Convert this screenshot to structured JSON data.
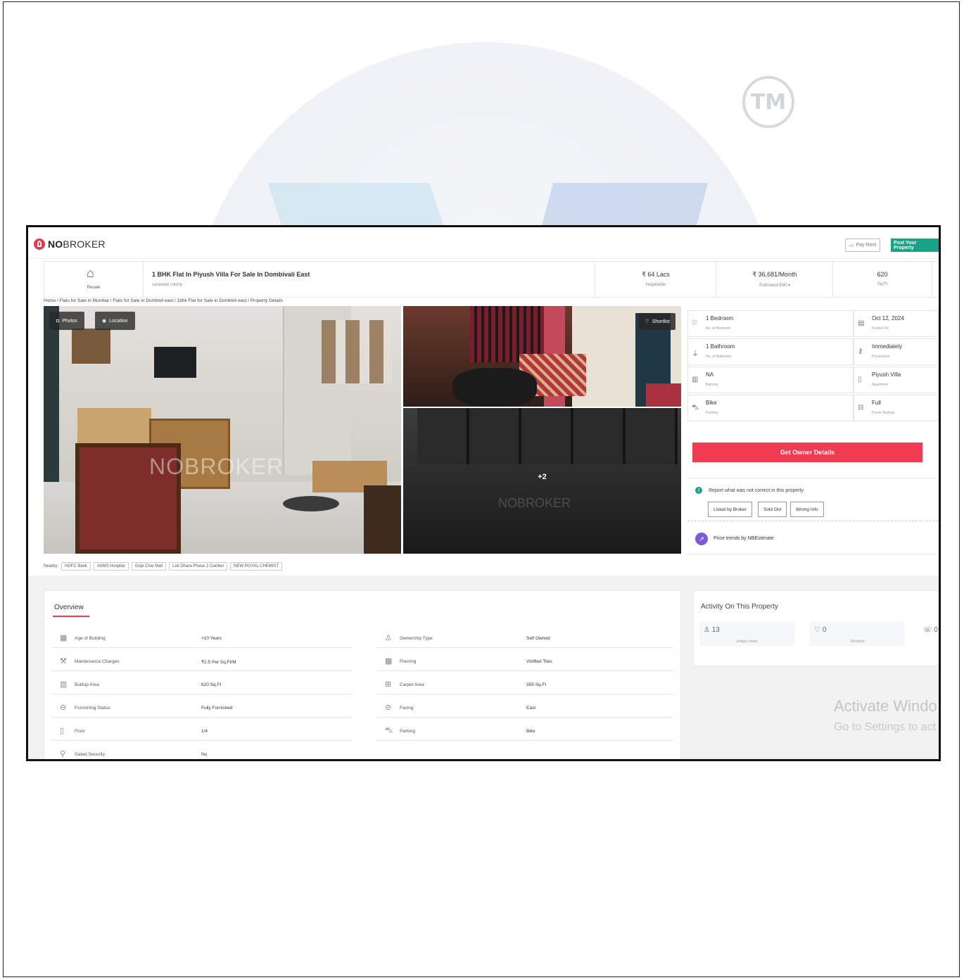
{
  "colors": {
    "brand_red": "#f03c50",
    "brand_green": "#18a389",
    "report_teal": "#19a38a",
    "trend_purple": "#7c5cd6"
  },
  "watermark": {
    "tm": "TM"
  },
  "header": {
    "logo_bold": "NO",
    "logo_rest": "BROKER",
    "pay_rent": "Pay Rent",
    "post_property": "Post Your Property"
  },
  "property": {
    "type_label": "Resale",
    "title": "1 BHK Flat In Piyush Villa For Sale In Dombivali East",
    "subtitle": "saraswat colony",
    "price": "₹ 64 Lacs",
    "price_note": "Negotiable",
    "emi": "₹ 36,681/Month",
    "emi_note": "Estimated EMI ▾",
    "area": "620",
    "area_unit": "Sq.Ft"
  },
  "breadcrumb": "Home / Flats for Sale in Mumbai / Flats for Sale in Dombivli east / 1bhk Flat for Sale in Dombivli east / Property Details",
  "gallery": {
    "photos_label": "Photos",
    "location_label": "Location",
    "shortlist_label": "Shortlist",
    "more_count": "+2",
    "watermark": "NOBROKER"
  },
  "nearby": {
    "label": "Nearby:",
    "places": [
      "HDFC Bank",
      "AIIMS Hospital",
      "Gopi Cine Mall",
      "Lok Dhara Phase 2 Garden",
      "NEW ROYAL CHEMIST"
    ]
  },
  "details": [
    {
      "icon": "bed-icon",
      "value": "1 Bedroom",
      "label": "No. of Bedroom"
    },
    {
      "icon": "calendar-icon",
      "value": "Oct 12, 2024",
      "label": "Posted On"
    },
    {
      "icon": "bath-icon",
      "value": "1 Bathroom",
      "label": "No. of Bathroom"
    },
    {
      "icon": "key-icon",
      "value": "Immediately",
      "label": "Possession"
    },
    {
      "icon": "balcony-icon",
      "value": "NA",
      "label": "Balcony"
    },
    {
      "icon": "building-icon",
      "value": "Piyush Villa",
      "label": "Apartment"
    },
    {
      "icon": "parking-icon",
      "value": "Bike",
      "label": "Parking"
    },
    {
      "icon": "power-icon",
      "value": "Full",
      "label": "Power Backup"
    }
  ],
  "owner_button": "Get Owner Details",
  "report": {
    "text": "Report what was not correct in this property",
    "options": [
      "Listed by Broker",
      "Sold Out",
      "Wrong Info"
    ]
  },
  "trends": {
    "label": "Price trends by NBEstimate"
  },
  "overview": {
    "title": "Overview",
    "left": [
      {
        "key": "Age of Building",
        "value": ">10 Years"
      },
      {
        "key": "Maintenance Charges",
        "value": "₹2.5 Per Sq.Ft/M"
      },
      {
        "key": "Builtup Area",
        "value": "620 Sq.Ft"
      },
      {
        "key": "Furnishing Status",
        "value": "Fully Furnished"
      },
      {
        "key": "Floor",
        "value": "1/4"
      },
      {
        "key": "Gated Security",
        "value": "No"
      }
    ],
    "right": [
      {
        "key": "Ownership Type",
        "value": "Self Owned"
      },
      {
        "key": "Flooring",
        "value": "Vitrified Tiles"
      },
      {
        "key": "Carpet Area",
        "value": "355 Sq.Ft"
      },
      {
        "key": "Facing",
        "value": "East"
      },
      {
        "key": "Parking",
        "value": "Bike"
      }
    ]
  },
  "activity": {
    "title": "Activity On This Property",
    "stats": [
      {
        "icon": "person-icon",
        "value": "13",
        "label": "Unique Views"
      },
      {
        "icon": "heart-icon",
        "value": "0",
        "label": "Shortlists"
      },
      {
        "icon": "contact-icon",
        "value": "0",
        "label": ""
      }
    ]
  },
  "windows_notice": {
    "line1": "Activate Windo",
    "line2": "Go to Settings to act"
  }
}
